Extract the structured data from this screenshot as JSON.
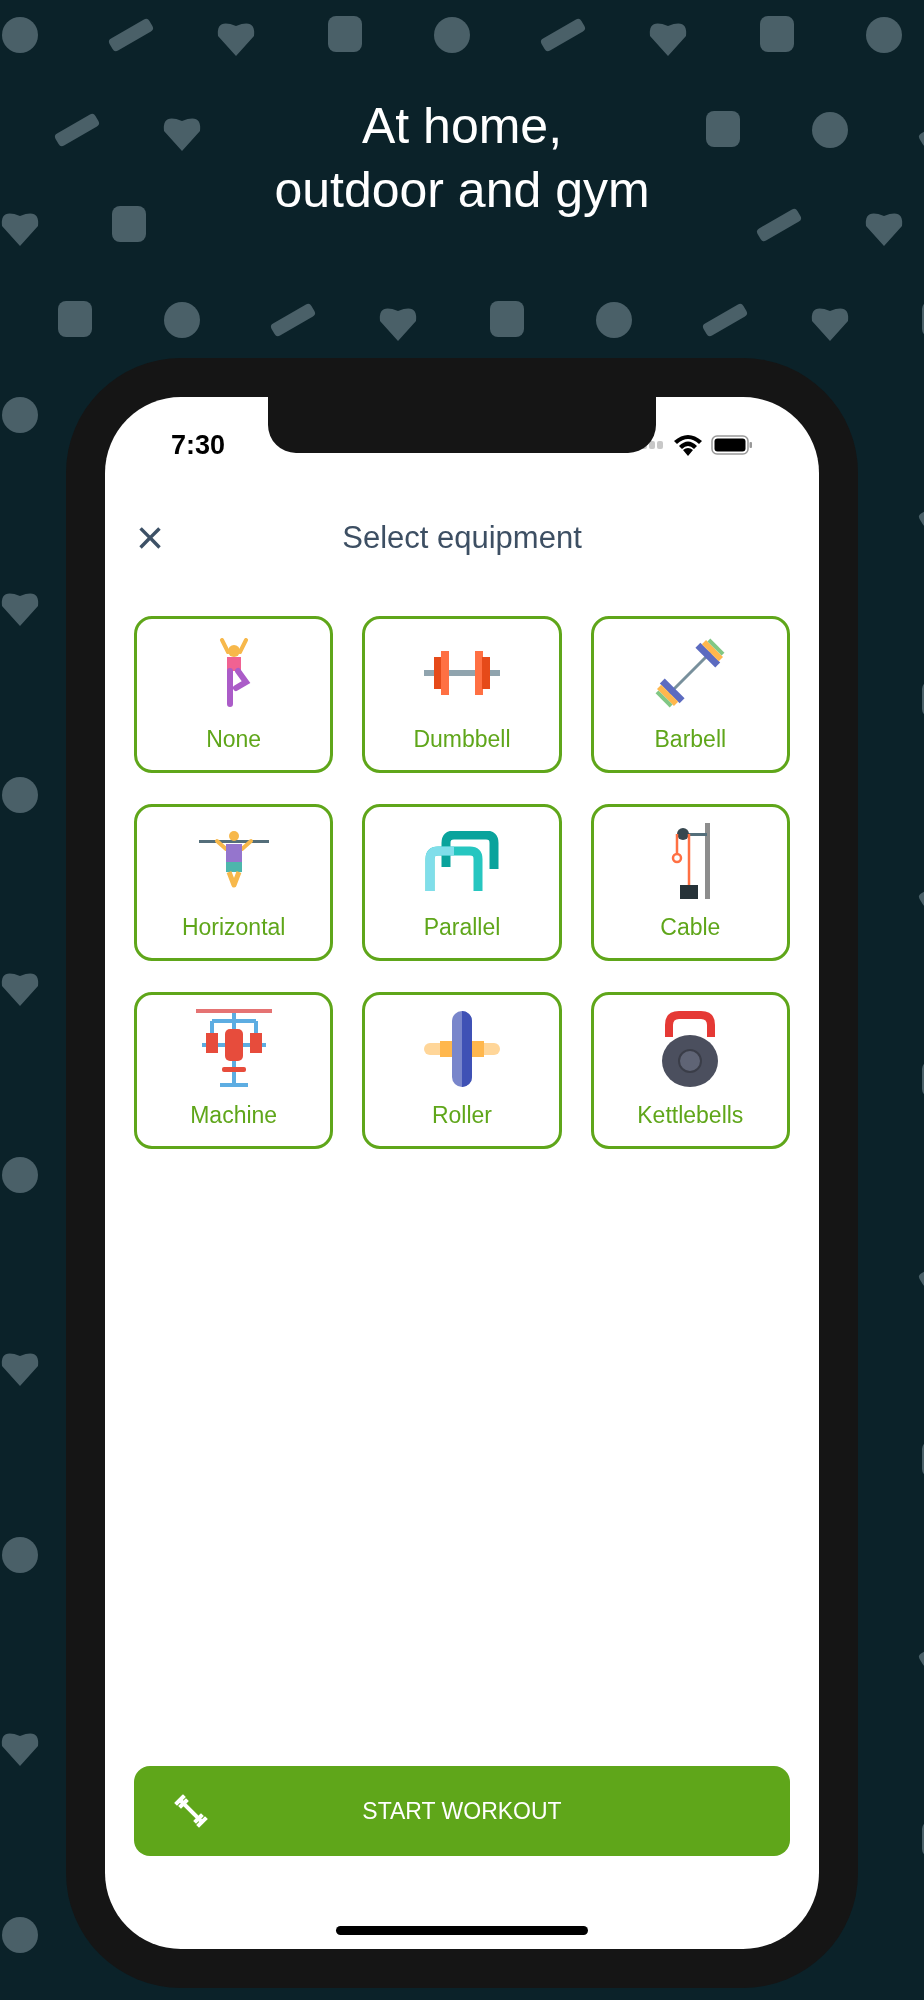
{
  "headline": [
    "At home,",
    "outdoor and gym"
  ],
  "status_bar": {
    "time": "7:30"
  },
  "header": {
    "close": "×",
    "title": "Select equipment"
  },
  "equipment": [
    {
      "label": "None"
    },
    {
      "label": "Dumbbell"
    },
    {
      "label": "Barbell"
    },
    {
      "label": "Horizontal"
    },
    {
      "label": "Parallel"
    },
    {
      "label": "Cable"
    },
    {
      "label": "Machine"
    },
    {
      "label": "Roller"
    },
    {
      "label": "Kettlebells"
    }
  ],
  "start_button": {
    "label": "START WORKOUT"
  }
}
